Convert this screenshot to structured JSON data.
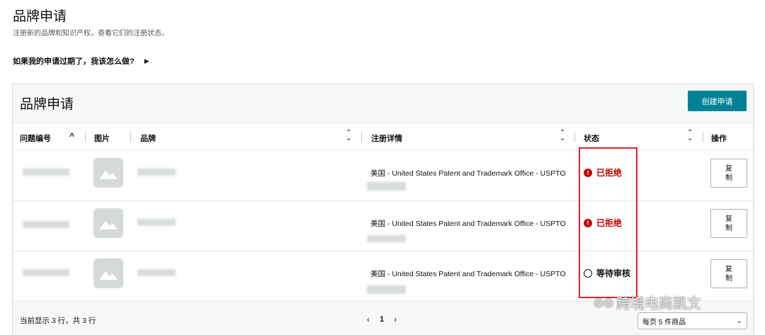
{
  "page": {
    "title": "品牌申请",
    "subtitle": "注册新的品牌和知识产权。查看它们的注册状态。",
    "faq_link": "如果我的申请过期了，我该怎么做?"
  },
  "card": {
    "title": "品牌申请",
    "create_button": "创建申请"
  },
  "columns": {
    "case_id": "问题编号",
    "image": "图片",
    "brand": "品牌",
    "registration": "注册详情",
    "status": "状态",
    "action": "操作"
  },
  "rows": [
    {
      "registration": "美国 - United States Patent and Trademark Office - USPTO",
      "status": "已拒绝",
      "status_type": "rejected",
      "status_icon": "!",
      "action": "复制"
    },
    {
      "registration": "美国 - United States Patent and Trademark Office - USPTO",
      "status": "已拒绝",
      "status_type": "rejected",
      "status_icon": "!",
      "action": "复制"
    },
    {
      "registration": "美国 - United States Patent and Trademark Office - USPTO",
      "status": "等待审核",
      "status_type": "pending",
      "status_icon": "◷",
      "action": "复制"
    }
  ],
  "footer": {
    "count_text": "当前显示 3 行，共 3 行",
    "current_page": "1",
    "per_page": "每页 5 件商品"
  },
  "watermark": {
    "text": "跨境电商凯文"
  },
  "colors": {
    "primary_button": "#008296",
    "rejected": "#c40000",
    "highlight_box": "#e0222b"
  }
}
